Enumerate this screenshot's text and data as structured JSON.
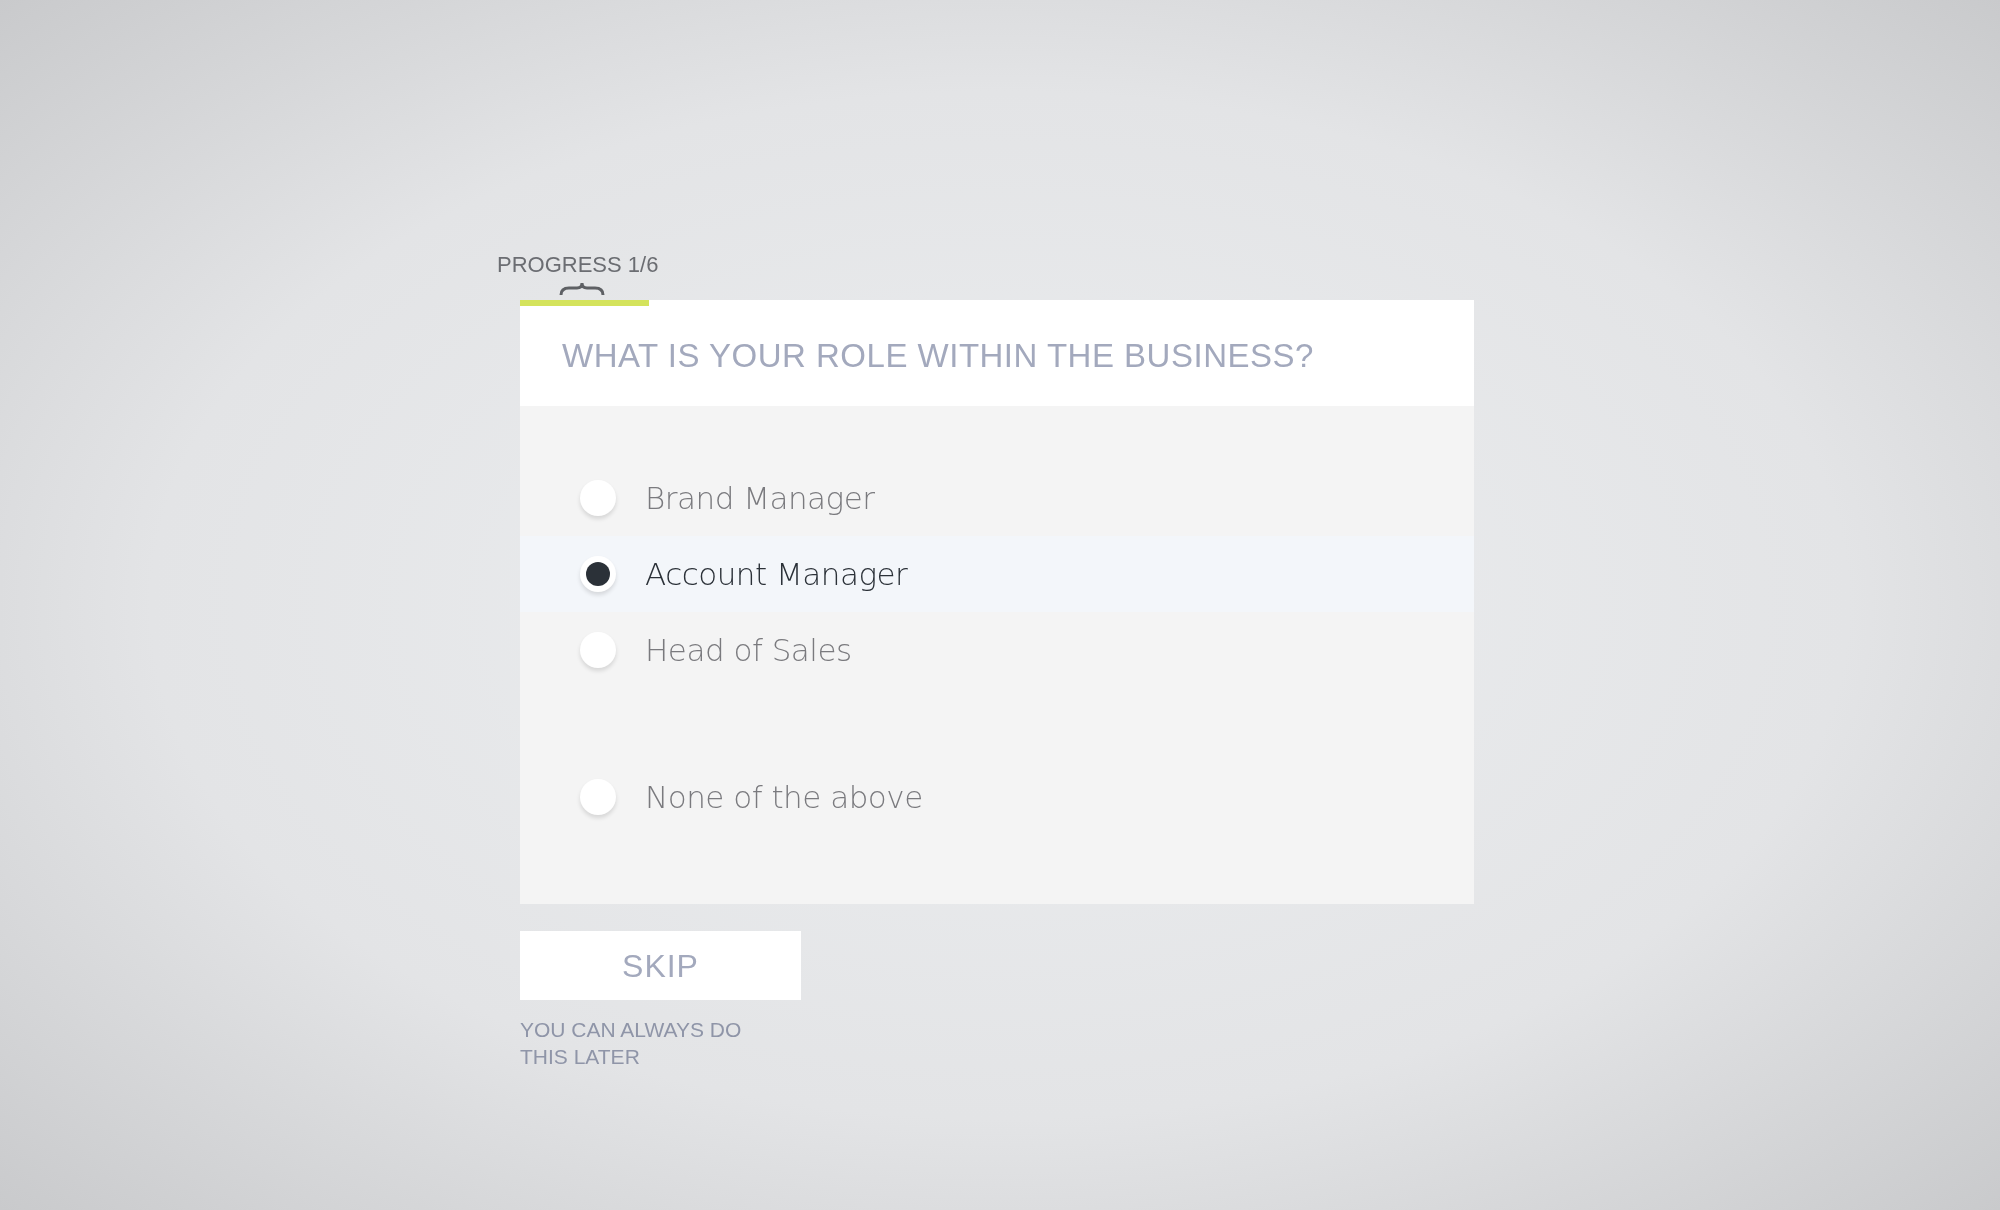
{
  "progress": {
    "label": "PROGRESS 1/6",
    "level": 0.135
  },
  "question": "WHAT IS YOUR ROLE WITHIN THE BUSINESS?",
  "options": [
    {
      "label": "Brand Manager",
      "selected": false
    },
    {
      "label": "Account Manager",
      "selected": true
    },
    {
      "label": "Head of Sales",
      "selected": false
    }
  ],
  "none_option": {
    "label": "None of the above",
    "selected": false
  },
  "skip": {
    "label": "SKIP",
    "note": "YOU CAN ALWAYS DO THIS LATER"
  }
}
